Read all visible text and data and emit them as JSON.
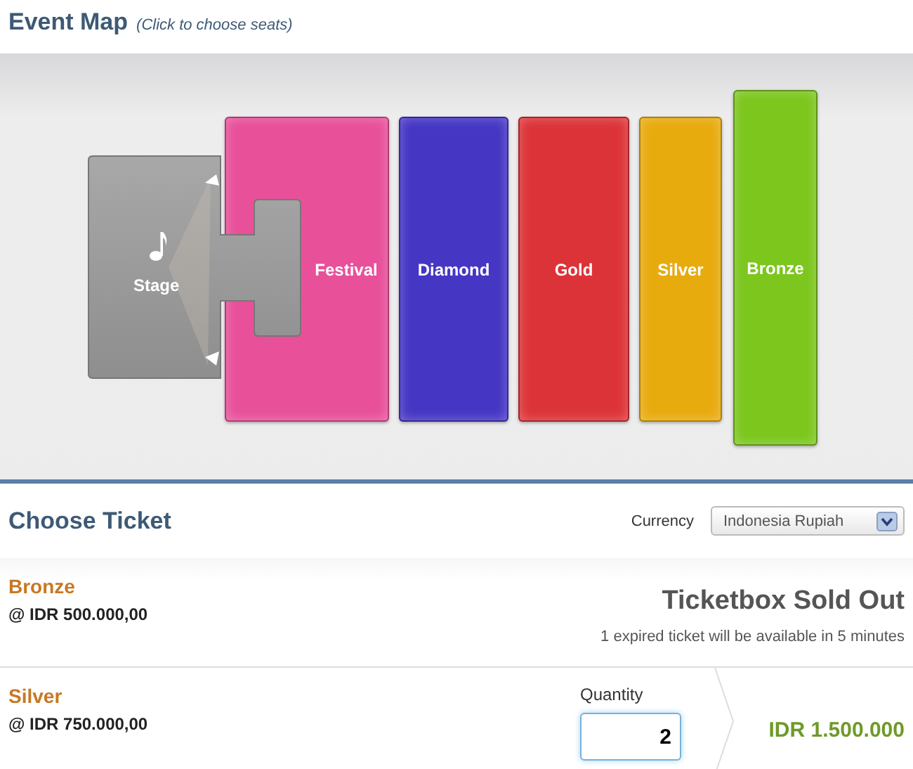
{
  "event_map": {
    "title": "Event Map",
    "hint": "(Click to choose seats)",
    "stage": {
      "label": "Stage"
    },
    "zones": [
      {
        "name": "Festival",
        "color": "#e8509a"
      },
      {
        "name": "Diamond",
        "color": "#4536c4"
      },
      {
        "name": "Gold",
        "color": "#dc3338"
      },
      {
        "name": "Silver",
        "color": "#e8ab0e"
      },
      {
        "name": "Bronze",
        "color": "#7cc61e"
      }
    ]
  },
  "choose_ticket": {
    "title": "Choose Ticket",
    "currency_label": "Currency",
    "currency": "Indonesia Rupiah",
    "tickets": [
      {
        "kind": "sold_out",
        "name": "Bronze",
        "price": "@ IDR 500.000,00",
        "status": "Ticketbox Sold Out",
        "note": "1 expired ticket will be available in 5 minutes"
      },
      {
        "kind": "quantity",
        "name": "Silver",
        "price": "@ IDR 750.000,00",
        "quantity_label": "Quantity",
        "quantity": "2",
        "total": "IDR 1.500.000"
      }
    ]
  }
}
